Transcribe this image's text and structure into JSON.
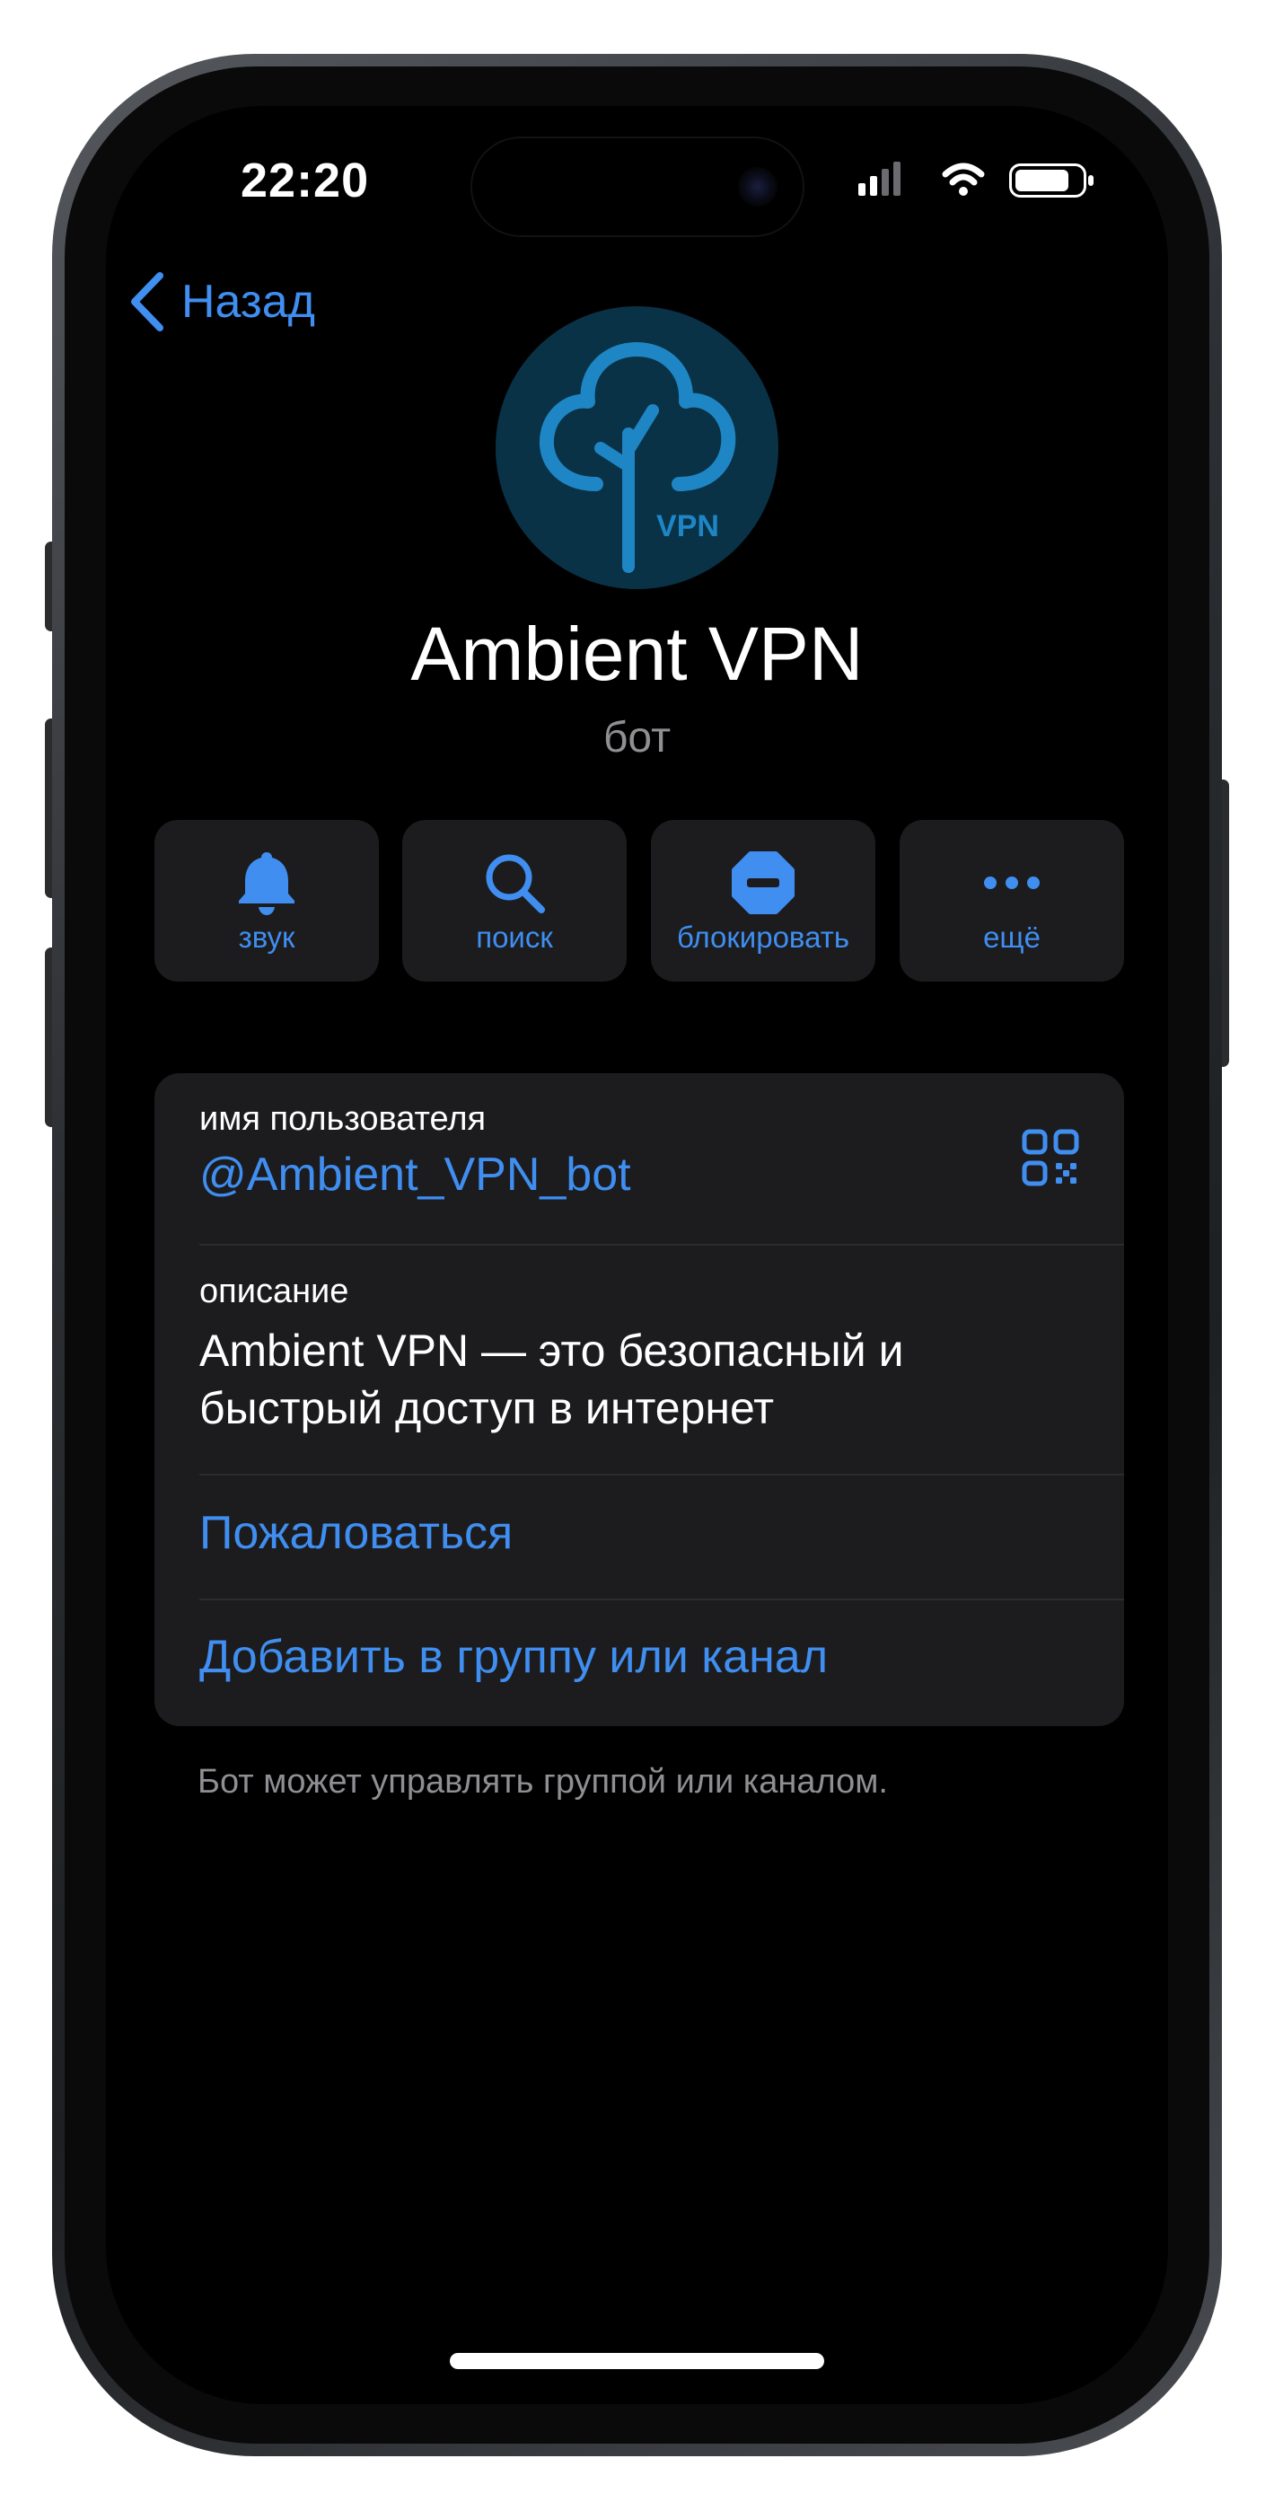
{
  "status_bar": {
    "time": "22:20",
    "icons": [
      "cellular-signal-icon",
      "wifi-icon",
      "battery-icon"
    ]
  },
  "nav": {
    "back_label": "Назад"
  },
  "profile": {
    "avatar_text": "VPN",
    "name": "Ambient VPN",
    "subtitle": "бот"
  },
  "actions": [
    {
      "label": "звук",
      "icon": "bell-icon"
    },
    {
      "label": "поиск",
      "icon": "search-icon"
    },
    {
      "label": "блокировать",
      "icon": "block-icon"
    },
    {
      "label": "ещё",
      "icon": "more-icon"
    }
  ],
  "info": {
    "username_label": "имя пользователя",
    "username": "@Ambient_VPN_bot",
    "description_label": "описание",
    "description_line1": "Ambient VPN — это безопасный и",
    "description_line2": "быстрый доступ в интернет",
    "report": "Пожаловаться",
    "add_to_group": "Добавить в группу или канал"
  },
  "footnote": "Бот может управлять группой или каналом.",
  "colors": {
    "accent": "#3f8ef0",
    "card_bg": "#1c1c1e",
    "screen_bg": "#000000",
    "secondary_text": "#8e8e93",
    "avatar_bg": "#093247",
    "avatar_fg": "#1e86c5"
  }
}
